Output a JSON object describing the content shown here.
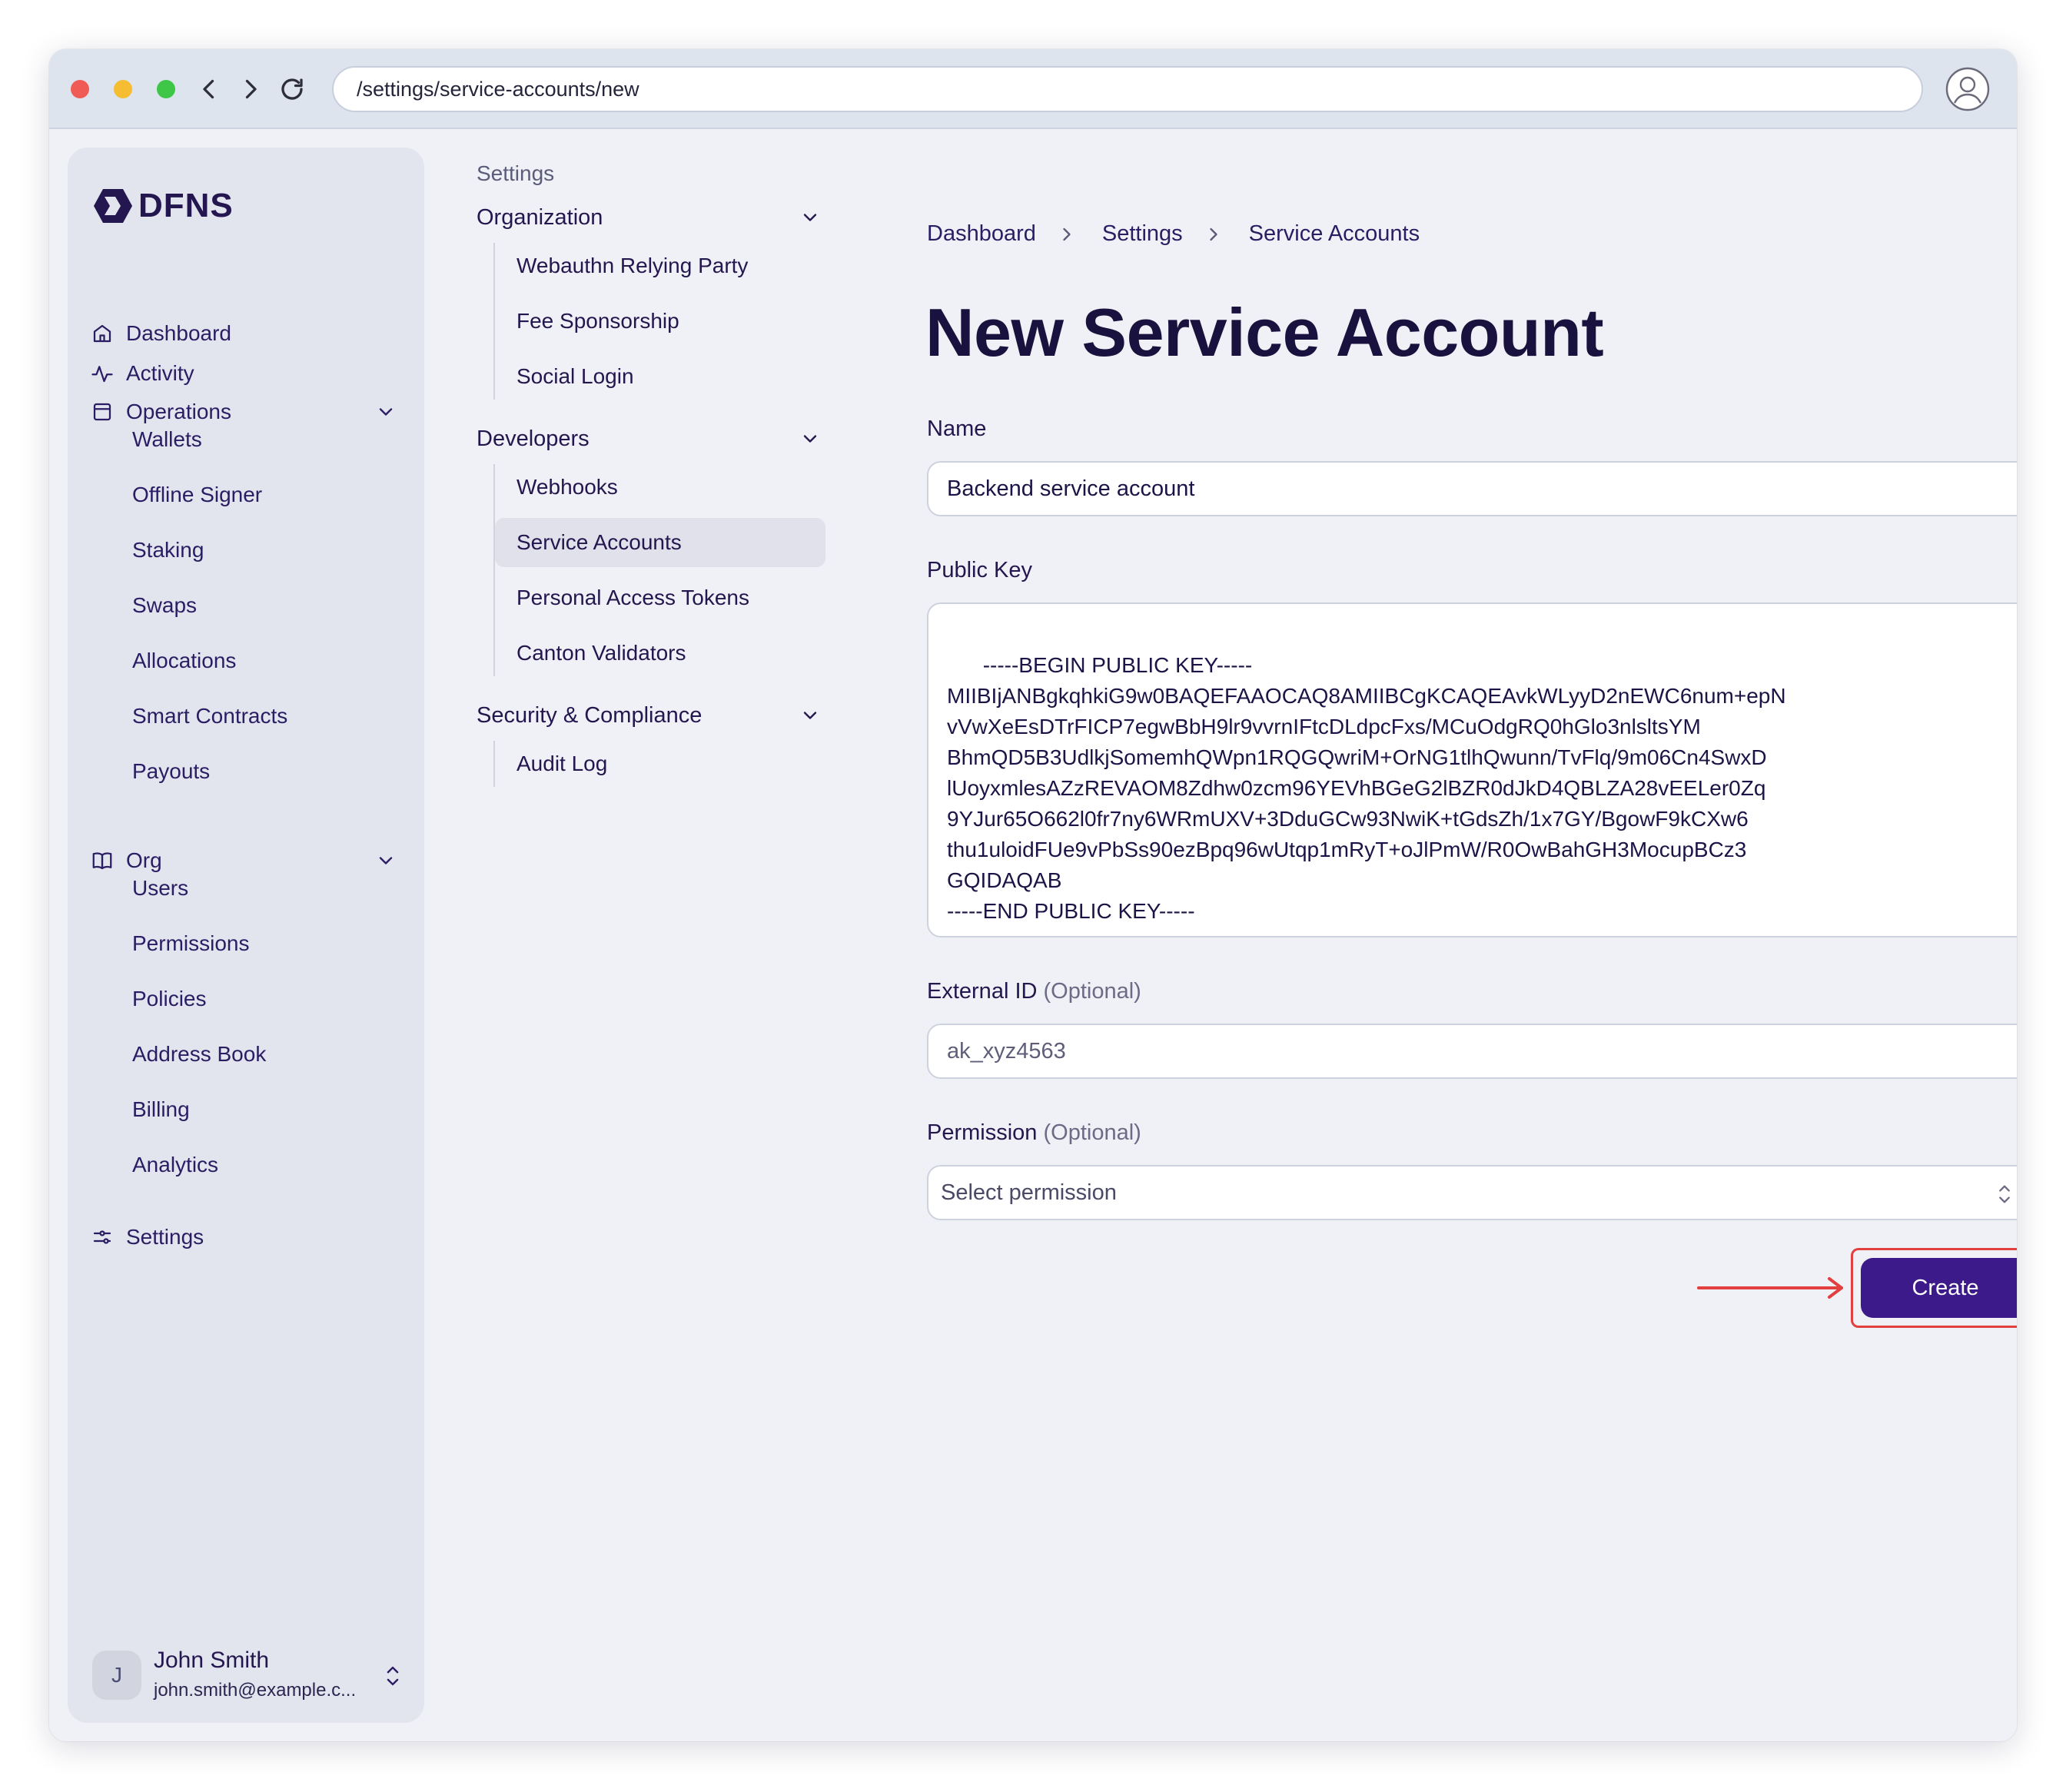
{
  "browser": {
    "url": "/settings/service-accounts/new"
  },
  "brand": {
    "name": "DFNS",
    "accent": "#3d1a8a"
  },
  "sidebar": {
    "items": [
      {
        "label": "Dashboard",
        "icon": "home-icon"
      },
      {
        "label": "Activity",
        "icon": "activity-icon"
      },
      {
        "label": "Operations",
        "icon": "calendar-icon",
        "expanded": true,
        "children": [
          "Wallets",
          "Offline Signer",
          "Staking",
          "Swaps",
          "Allocations",
          "Smart Contracts",
          "Payouts"
        ]
      },
      {
        "label": "Org",
        "icon": "book-icon",
        "expanded": true,
        "children": [
          "Users",
          "Permissions",
          "Policies",
          "Address Book",
          "Billing",
          "Analytics"
        ]
      },
      {
        "label": "Settings",
        "icon": "sliders-icon"
      }
    ],
    "user": {
      "initial": "J",
      "name": "John Smith",
      "email": "john.smith@example.c..."
    }
  },
  "settings_nav": {
    "title": "Settings",
    "groups": [
      {
        "label": "Organization",
        "items": [
          "Webauthn Relying Party",
          "Fee Sponsorship",
          "Social Login"
        ]
      },
      {
        "label": "Developers",
        "items": [
          "Webhooks",
          "Service Accounts",
          "Personal Access Tokens",
          "Canton Validators"
        ],
        "active": "Service Accounts"
      },
      {
        "label": "Security & Compliance",
        "items": [
          "Audit Log"
        ]
      }
    ]
  },
  "main": {
    "breadcrumb": [
      "Dashboard",
      "Settings",
      "Service Accounts"
    ],
    "title": "New Service Account",
    "form": {
      "name_label": "Name",
      "name_value": "Backend service account",
      "public_key_label": "Public Key",
      "public_key_value": "-----BEGIN PUBLIC KEY-----\nMIIBIjANBgkqhkiG9w0BAQEFAAOCAQ8AMIIBCgKCAQEAvkWLyyD2nEWC6num+epN\nvVwXeEsDTrFICP7egwBbH9lr9vvrnIFtcDLdpcFxs/MCuOdgRQ0hGlo3nlsltsYM\nBhmQD5B3UdlkjSomemhQWpn1RQGQwriM+OrNG1tlhQwunn/TvFlq/9m06Cn4SwxD\nlUoyxmlesAZzREVAOM8Zdhw0zcm96YEVhBGeG2lBZR0dJkD4QBLZA28vEELer0Zq\n9YJur65O662l0fr7ny6WRmUXV+3DduGCw93NwiK+tGdsZh/1x7GY/BgowF9kCXw6\nthu1uloidFUe9vPbSs90ezBpq96wUtqp1mRyT+oJlPmW/R0OwBahGH3MocupBCz3\nGQIDAQAB\n-----END PUBLIC KEY-----",
      "external_id_label": "External ID",
      "external_id_optional": "(Optional)",
      "external_id_placeholder": "ak_xyz4563",
      "permission_label": "Permission",
      "permission_optional": "(Optional)",
      "permission_value": "Select permission",
      "create_label": "Create"
    },
    "highlight_color": "#e2403f"
  }
}
